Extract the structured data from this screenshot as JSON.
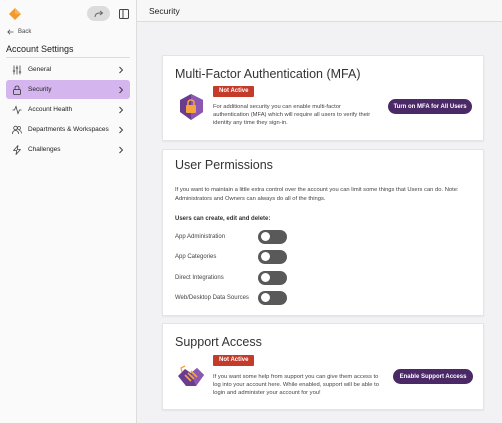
{
  "sidebar": {
    "back_label": "Back",
    "title": "Account Settings",
    "items": [
      {
        "label": "General",
        "icon": "sliders-icon"
      },
      {
        "label": "Security",
        "icon": "lock-icon"
      },
      {
        "label": "Account Health",
        "icon": "activity-icon"
      },
      {
        "label": "Departments & Workspaces",
        "icon": "users-icon"
      },
      {
        "label": "Challenges",
        "icon": "lightning-icon"
      }
    ]
  },
  "header": {
    "title": "Security"
  },
  "mfa": {
    "title": "Multi-Factor Authentication (MFA)",
    "status": "Not Active",
    "description": "For additional security you can enable multi-factor authentication (MFA) which will require all users to verify their identity any time they sign-in.",
    "button_label": "Turn on MFA for All Users"
  },
  "permissions": {
    "title": "User Permissions",
    "intro": "If you want to maintain a little extra control over the account you can limit some things that Users can do. Note: Administrators and Owners can always do all of the things.",
    "subheading": "Users can create, edit and delete:",
    "items": [
      {
        "label": "App Administration",
        "enabled": false
      },
      {
        "label": "App Categories",
        "enabled": false
      },
      {
        "label": "Direct Integrations",
        "enabled": false
      },
      {
        "label": "Web/Desktop Data Sources",
        "enabled": false
      }
    ]
  },
  "support": {
    "title": "Support Access",
    "status": "Not Active",
    "description": "If you want some help from support you can give them access to log into your account here. While enabled, support will be able to login and administer your account for you!",
    "button_label": "Enable Support Access"
  },
  "colors": {
    "accent": "#4a2966",
    "active_nav": "#d5b5ee",
    "badge_red": "#c53b2a",
    "toggle_off": "#595959"
  }
}
